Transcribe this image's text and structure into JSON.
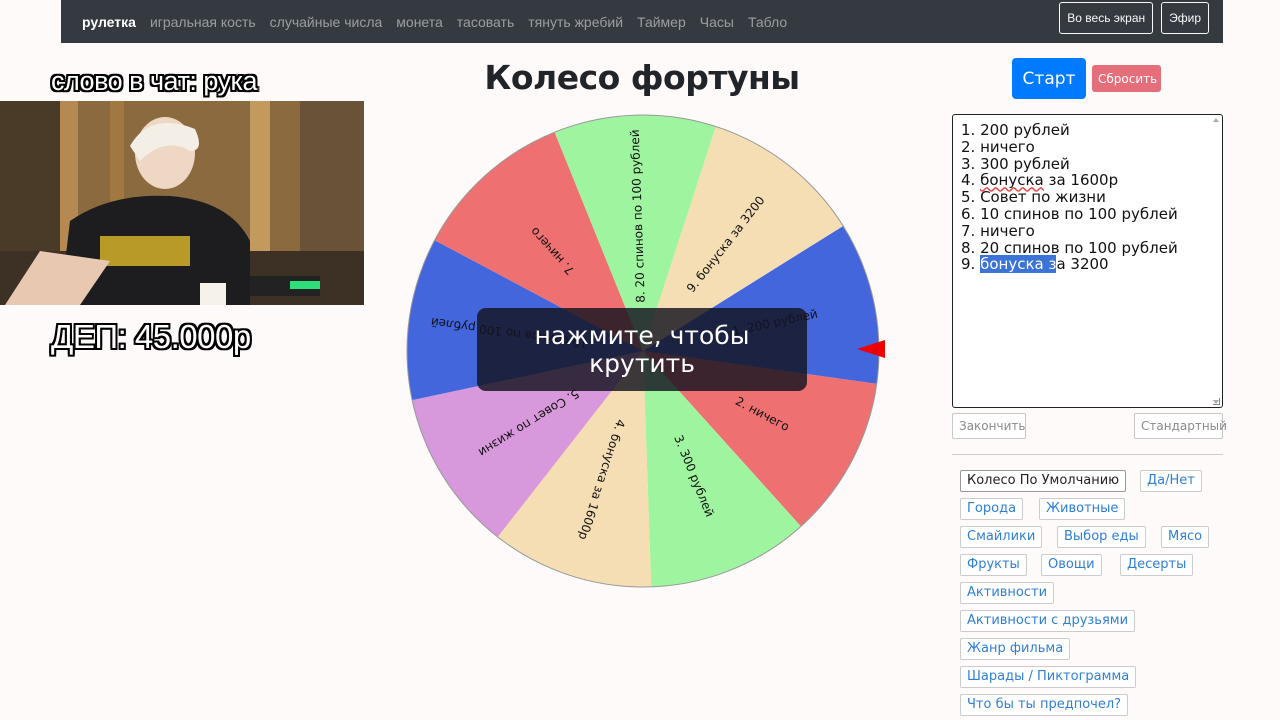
{
  "nav": {
    "brand": "рулетка",
    "items": [
      "игральная кость",
      "случайные числа",
      "монета",
      "тасовать",
      "тянуть жребий",
      "Таймер",
      "Часы",
      "Табло"
    ],
    "fullscreen": "Во весь экран",
    "live": "Эфир"
  },
  "overlay": {
    "word": "слово в чат: рука",
    "deposit": "ДЕП: 45.000р"
  },
  "title": "Колесо фортуны",
  "wheel": {
    "spin_hint": "нажмите, чтобы крутить",
    "segments": [
      {
        "label": "1. 200 рублей",
        "color": "#4466dd"
      },
      {
        "label": "2. ничего",
        "color": "#ee7070"
      },
      {
        "label": "3. 300 рублей",
        "color": "#9ff59f"
      },
      {
        "label": "4. бонуска за 1600р",
        "color": "#f5deb3"
      },
      {
        "label": "5. Совет по жизни",
        "color": "#d898dc"
      },
      {
        "label": "10 спинов по 100 рублей",
        "color": "#4466dd"
      },
      {
        "label": "7. ничего",
        "color": "#ee7070"
      },
      {
        "label": "8. 20 спинов по 100 рублей",
        "color": "#9ff59f"
      },
      {
        "label": "9. бонуска за 3200",
        "color": "#f5deb3"
      }
    ]
  },
  "controls": {
    "start": "Старт",
    "reset": "Сбросить",
    "finish": "Закончить",
    "standard": "Стандартный"
  },
  "entries": {
    "lines": [
      "1. 200 рублей",
      "2. ничего",
      "3. 300 рублей",
      "4. бонуска за 1600р",
      "5. Совет по жизни",
      "6. 10 спинов по 100 рублей",
      "7. ничего",
      "8. 20 спинов по 100 рублей"
    ],
    "last_prefix": "9. ",
    "last_selected": "бонуска з",
    "last_rest": "а 3200"
  },
  "presets": {
    "default_wheel": "Колесо По Умолчанию",
    "yes_no": "Да/Нет",
    "cities": "Города",
    "animals": "Животные",
    "emoji": "Смайлики",
    "food": "Выбор еды",
    "meat": "Мясо",
    "fruits": "Фрукты",
    "vegetables": "Овощи",
    "desserts": "Десерты",
    "activities": "Активности",
    "activities_friends": "Активности с друзьями",
    "movie_genre": "Жанр фильма",
    "charades": "Шарады / Пиктограмма",
    "would_you_rather": "Что бы ты предпочел?"
  }
}
